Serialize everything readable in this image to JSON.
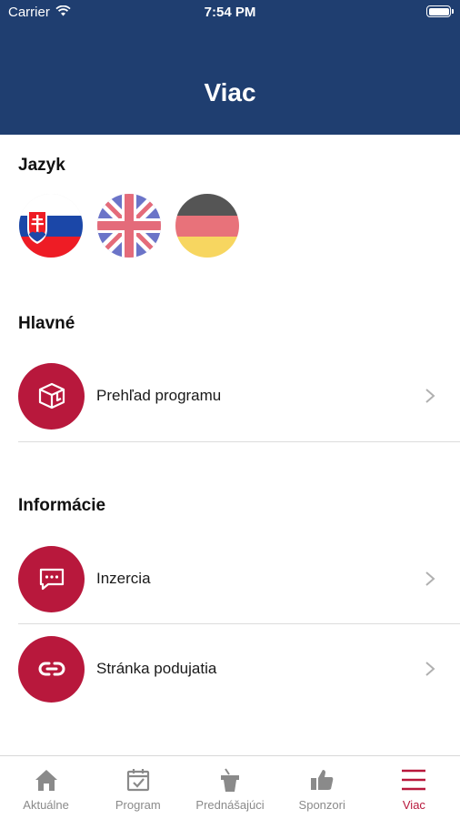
{
  "status_bar": {
    "carrier": "Carrier",
    "time": "7:54 PM"
  },
  "header": {
    "title": "Viac"
  },
  "sections": {
    "language": {
      "title": "Jazyk"
    },
    "main": {
      "title": "Hlavné"
    },
    "info": {
      "title": "Informácie"
    }
  },
  "flags": [
    {
      "name": "slovak-flag-icon"
    },
    {
      "name": "british-flag-icon"
    },
    {
      "name": "german-flag-icon"
    }
  ],
  "rows": {
    "program": {
      "label": "Prehľad programu",
      "icon": "box-icon"
    },
    "ads": {
      "label": "Inzercia",
      "icon": "chat-bubble-icon"
    },
    "website": {
      "label": "Stránka podujatia",
      "icon": "link-icon"
    }
  },
  "tabbar": {
    "items": [
      {
        "label": "Aktuálne",
        "icon": "home-icon"
      },
      {
        "label": "Program",
        "icon": "calendar-check-icon"
      },
      {
        "label": "Prednášajúci",
        "icon": "podium-icon"
      },
      {
        "label": "Sponzori",
        "icon": "thumbs-up-icon"
      },
      {
        "label": "Viac",
        "icon": "menu-icon"
      }
    ],
    "active": "Viac"
  },
  "colors": {
    "header": "#1f3e70",
    "accent": "#b8183c",
    "inactive": "#8a8a8a"
  }
}
